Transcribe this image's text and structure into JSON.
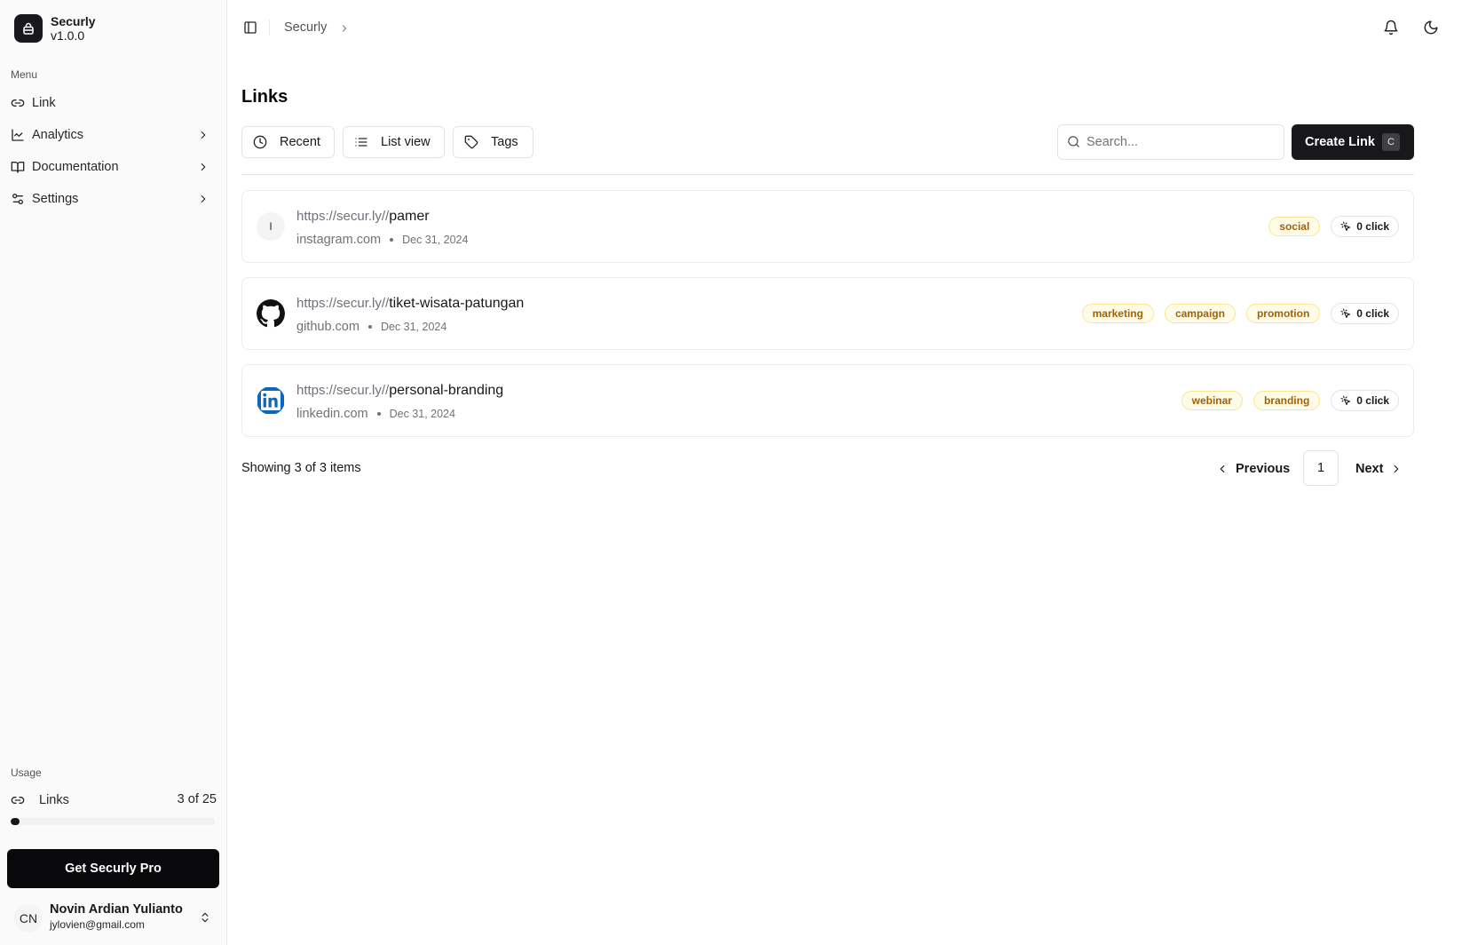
{
  "app": {
    "name": "Securly",
    "version": "v1.0.0"
  },
  "sidebar": {
    "menu_label": "Menu",
    "items": [
      {
        "label": "Link",
        "icon": "link-icon",
        "has_submenu": false
      },
      {
        "label": "Analytics",
        "icon": "chart-line-icon",
        "has_submenu": true
      },
      {
        "label": "Documentation",
        "icon": "book-icon",
        "has_submenu": true
      },
      {
        "label": "Settings",
        "icon": "settings-sliders-icon",
        "has_submenu": true
      }
    ],
    "usage": {
      "label": "Usage",
      "item_label": "Links",
      "count_text": "3 of 25",
      "used": 3,
      "limit": 25
    },
    "pro_button": "Get Securly Pro",
    "user": {
      "initials": "CN",
      "name": "Novin Ardian Yulianto",
      "email": "jylovien@gmail.com"
    }
  },
  "topbar": {
    "breadcrumb": "Securly"
  },
  "main": {
    "title": "Links",
    "toolbar": {
      "recent": "Recent",
      "list_view": "List view",
      "tags": "Tags",
      "search_placeholder": "Search...",
      "create_label": "Create Link",
      "create_shortcut": "C"
    },
    "links": [
      {
        "prefix": "https://secur.ly//",
        "slug": "pamer",
        "domain": "instagram.com",
        "date": "Dec 31, 2024",
        "favicon": "letter",
        "favicon_letter": "I",
        "tags": [
          "social"
        ],
        "clicks": "0 click"
      },
      {
        "prefix": "https://secur.ly//",
        "slug": "tiket-wisata-patungan",
        "domain": "github.com",
        "date": "Dec 31, 2024",
        "favicon": "github-icon",
        "tags": [
          "marketing",
          "campaign",
          "promotion"
        ],
        "clicks": "0 click"
      },
      {
        "prefix": "https://secur.ly//",
        "slug": "personal-branding",
        "domain": "linkedin.com",
        "date": "Dec 31, 2024",
        "favicon": "linkedin-icon",
        "tags": [
          "webinar",
          "branding"
        ],
        "clicks": "0 click"
      }
    ],
    "footer": {
      "showing": "Showing 3 of 3 items",
      "previous": "Previous",
      "page": "1",
      "next": "Next"
    }
  },
  "colors": {
    "primary": "#18181b",
    "tag_bg": "#fefce8",
    "tag_border": "#fde68a",
    "tag_text": "#a16207",
    "linkedin": "#0a66c2"
  }
}
